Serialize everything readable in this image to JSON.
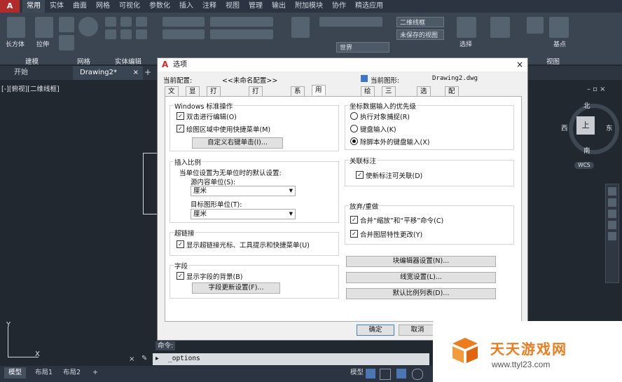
{
  "ribbon": {
    "app_logo": "A",
    "tabs": [
      "常用",
      "实体",
      "曲面",
      "网格",
      "可视化",
      "参数化",
      "插入",
      "注释",
      "视图",
      "管理",
      "输出",
      "附加模块",
      "协作",
      "精选应用"
    ],
    "active_tab": 0,
    "groups": [
      "建模",
      "网格",
      "实体编辑",
      "视图"
    ],
    "tools": {
      "box": "长方体",
      "extrude": "拉伸",
      "select": "选择",
      "base": "基点"
    },
    "visual_style": "二维线框",
    "unsaved_view": "未保存的视图",
    "ucs": "世界"
  },
  "file_tabs": {
    "start": "开始",
    "drawing": "Drawing2*"
  },
  "viewport_label": "[-][俯视][二维线框]",
  "viewcube": {
    "north": "北",
    "south": "南",
    "east": "东",
    "west": "西",
    "top": "上",
    "wcs": "WCS"
  },
  "dialog": {
    "title": "选项",
    "current_profile_label": "当前配置:",
    "current_profile_value": "<<未命名配置>>",
    "current_drawing_label": "当前图形:",
    "current_drawing_value": "Drawing2.dwg",
    "tabs": [
      "文件",
      "显示",
      "打开和保存",
      "打印和发布",
      "系统",
      "用户系统配置",
      "绘图",
      "三维建模",
      "选择集",
      "配置"
    ],
    "active_tab": 5,
    "windows_std": {
      "title": "Windows 标准操作",
      "dblclick": "双击进行编辑(O)",
      "shortcut": "绘图区域中使用快捷菜单(M)",
      "rightclick_btn": "自定义右键单击(I)..."
    },
    "insert_scale": {
      "title": "插入比例",
      "desc": "当单位设置为无单位时的默认设置:",
      "source_label": "源内容单位(S):",
      "source_value": "厘米",
      "target_label": "目标图形单位(T):",
      "target_value": "厘米"
    },
    "hyperlink": {
      "title": "超链接",
      "show": "显示超链接光标、工具提示和快捷菜单(U)"
    },
    "fields": {
      "title": "字段",
      "show_bg": "显示字段的背景(B)",
      "update_btn": "字段更新设置(F)..."
    },
    "coord_priority": {
      "title": "坐标数据输入的优先级",
      "osnap": "执行对象捕捉(R)",
      "keyboard": "键盘输入(K)",
      "keyboard_except": "除脚本外的键盘输入(X)"
    },
    "assoc_dim": {
      "title": "关联标注",
      "make_assoc": "使新标注可关联(D)"
    },
    "undo_redo": {
      "title": "放弃/重做",
      "combine_zoom": "合并“缩放”和“平移”命令(C)",
      "combine_layer": "合并图层特性更改(Y)"
    },
    "block_editor_btn": "块编辑器设置(N)...",
    "lineweight_btn": "线宽设置(L)...",
    "scale_list_btn": "默认比例列表(D)...",
    "ok": "确定",
    "cancel": "取消"
  },
  "command": {
    "prompt": "命令:",
    "input": "_options"
  },
  "status": {
    "model": "模型",
    "layout1": "布局1",
    "layout2": "布局2",
    "add": "+",
    "model_btn": "模型"
  },
  "axis": {
    "y": "Y",
    "x": "X"
  },
  "watermark": {
    "title": "天天游戏网",
    "url": "www.ttyl23.com"
  }
}
